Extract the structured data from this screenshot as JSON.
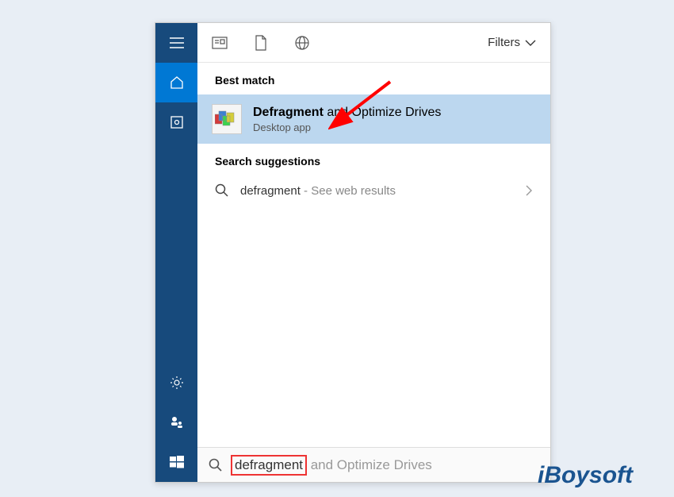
{
  "topbar": {
    "filters_label": "Filters"
  },
  "sections": {
    "best_match": "Best match",
    "search_suggestions": "Search suggestions"
  },
  "best_match_result": {
    "title_bold": "Defragment",
    "title_rest": " and Optimize Drives",
    "subtitle": "Desktop app"
  },
  "suggestion": {
    "query": "defragment",
    "separator": " - ",
    "sub": "See web results"
  },
  "search_input": {
    "typed": "defragment",
    "completion": " and Optimize Drives"
  },
  "watermark": {
    "text": "iBoysoft"
  }
}
